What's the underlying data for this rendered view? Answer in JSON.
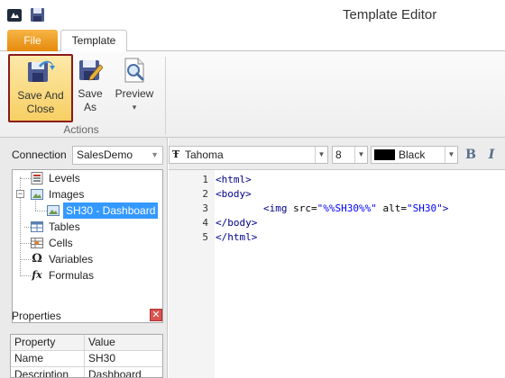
{
  "window": {
    "title": "Template Editor"
  },
  "ribbon": {
    "tabs": [
      {
        "label": "File",
        "active": false
      },
      {
        "label": "Template",
        "active": true
      }
    ],
    "buttons": {
      "save_and_close": {
        "line1": "Save And",
        "line2": "Close"
      },
      "save_as": {
        "line1": "Save",
        "line2": "As"
      },
      "preview": {
        "label": "Preview",
        "chevron": "▾"
      }
    },
    "group_label": "Actions"
  },
  "connection": {
    "label": "Connection",
    "value": "SalesDemo"
  },
  "tree": {
    "items": [
      {
        "label": "Levels",
        "icon": "levels-icon"
      },
      {
        "label": "Images",
        "icon": "image-icon",
        "expanded": true
      },
      {
        "label": "SH30 - Dashboard",
        "icon": "image-icon",
        "selected": true
      },
      {
        "label": "Tables",
        "icon": "table-icon"
      },
      {
        "label": "Cells",
        "icon": "cells-icon"
      },
      {
        "label": "Variables",
        "icon": "omega-icon",
        "glyph": "Ω"
      },
      {
        "label": "Formulas",
        "icon": "fx-icon",
        "glyph": "fx"
      }
    ],
    "expander_glyph": "−"
  },
  "properties": {
    "title": "Properties",
    "close_glyph": "✕",
    "headers": [
      "Property",
      "Value"
    ],
    "rows": [
      [
        "Name",
        "SH30"
      ],
      [
        "Description",
        "Dashboard"
      ]
    ]
  },
  "format_toolbar": {
    "font_glyph": "Ŧ",
    "font": "Tahoma",
    "size": "8",
    "color_name": "Black",
    "color_hex": "#000000",
    "bold_label": "B",
    "italic_label": "I",
    "dropdown_glyph": "▼"
  },
  "code": {
    "lines": [
      {
        "num": "1",
        "parts": [
          [
            "tag",
            "<html>"
          ]
        ]
      },
      {
        "num": "2",
        "parts": [
          [
            "tag",
            "<body>"
          ]
        ]
      },
      {
        "num": "3",
        "parts": [
          [
            "plain",
            "        "
          ],
          [
            "tag",
            "<img"
          ],
          [
            "attr",
            " src="
          ],
          [
            "str",
            "\"%%SH30%%\""
          ],
          [
            "attr",
            " alt="
          ],
          [
            "str",
            "\"SH30\""
          ],
          [
            "tag",
            ">"
          ]
        ]
      },
      {
        "num": "4",
        "parts": [
          [
            "tag",
            "</body>"
          ]
        ]
      },
      {
        "num": "5",
        "parts": [
          [
            "tag",
            "</html>"
          ]
        ]
      }
    ]
  },
  "colors": {
    "file_tab": "#e58a0c",
    "selection": "#3399ff",
    "highlight_border": "#8b1a1a",
    "tag": "#00008b",
    "string": "#0000ff"
  }
}
